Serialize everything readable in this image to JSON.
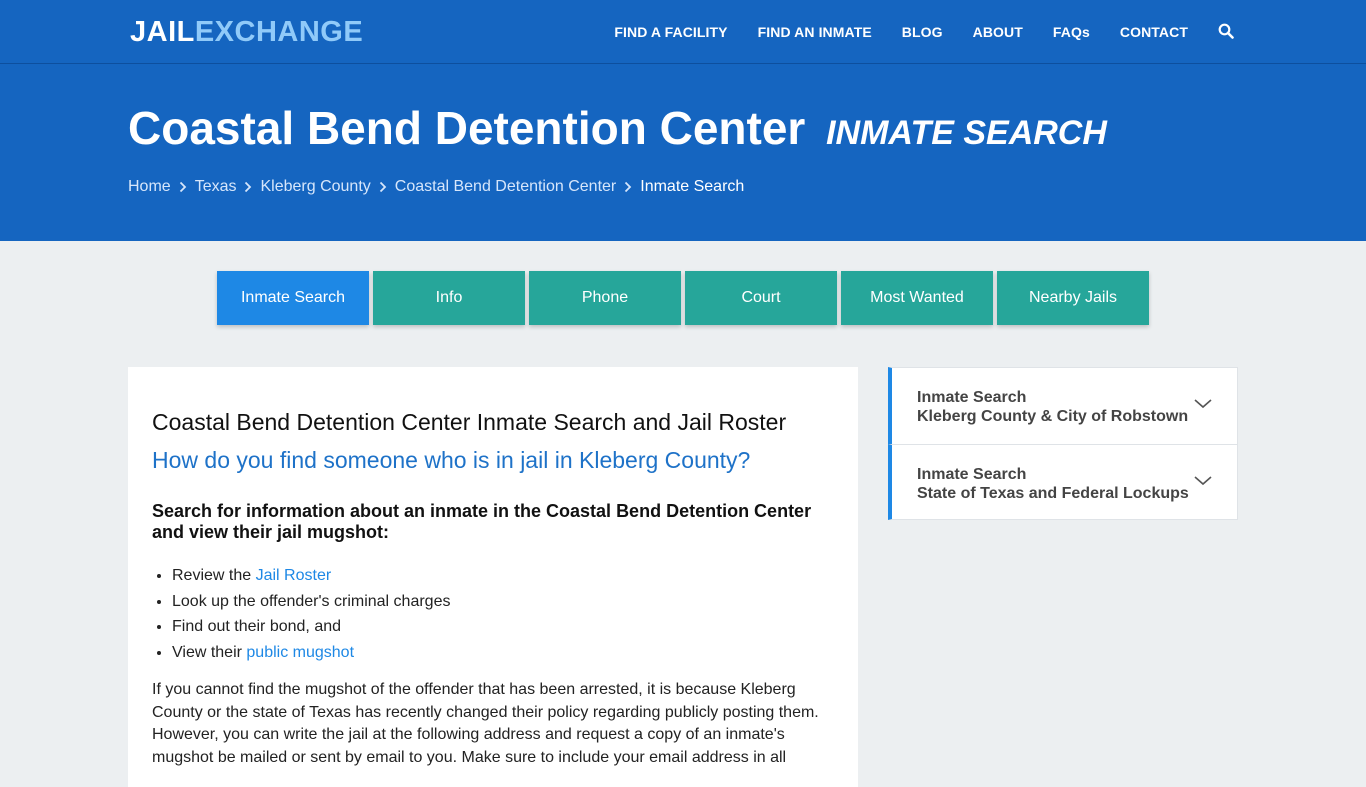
{
  "header": {
    "logo_part1": "JAIL",
    "logo_part2": "EXCHANGE",
    "nav": [
      "FIND A FACILITY",
      "FIND AN INMATE",
      "BLOG",
      "ABOUT",
      "FAQs",
      "CONTACT"
    ],
    "search_icon": "search-icon"
  },
  "hero": {
    "title": "Coastal Bend Detention Center",
    "subtitle": "INMATE SEARCH",
    "breadcrumbs": [
      "Home",
      "Texas",
      "Kleberg County",
      "Coastal Bend Detention Center"
    ],
    "breadcrumb_current": "Inmate Search"
  },
  "tabs": [
    "Inmate Search",
    "Info",
    "Phone",
    "Court",
    "Most Wanted",
    "Nearby Jails"
  ],
  "main": {
    "heading": "Coastal Bend Detention Center Inmate Search and Jail Roster",
    "question": "How do you find someone who is in jail in Kleberg County?",
    "subheading": "Search for information about an inmate in the Coastal Bend Detention Center and view their jail mugshot:",
    "list": {
      "item1_prefix": "Review the ",
      "item1_link": "Jail Roster",
      "item2": "Look up the offender's criminal charges",
      "item3": "Find out their bond, and",
      "item4_prefix": "View their ",
      "item4_link": "public mugshot"
    },
    "paragraph": "If you cannot find the mugshot of the offender that has been arrested, it is because Kleberg County or the state of Texas has recently changed their policy regarding publicly posting them. However, you can write the jail at the following address and request a copy of an inmate's mugshot be mailed or sent by email to you. Make sure to include your email address in all"
  },
  "sidebar": [
    {
      "line1": "Inmate Search",
      "line2": "Kleberg County & City of Robstown"
    },
    {
      "line1": "Inmate Search",
      "line2": "State of Texas and Federal Lockups"
    }
  ],
  "colors": {
    "brand_blue": "#1565c0",
    "tab_teal": "#26a69a",
    "tab_active": "#1e88e5",
    "link_blue": "#1e88e5"
  }
}
